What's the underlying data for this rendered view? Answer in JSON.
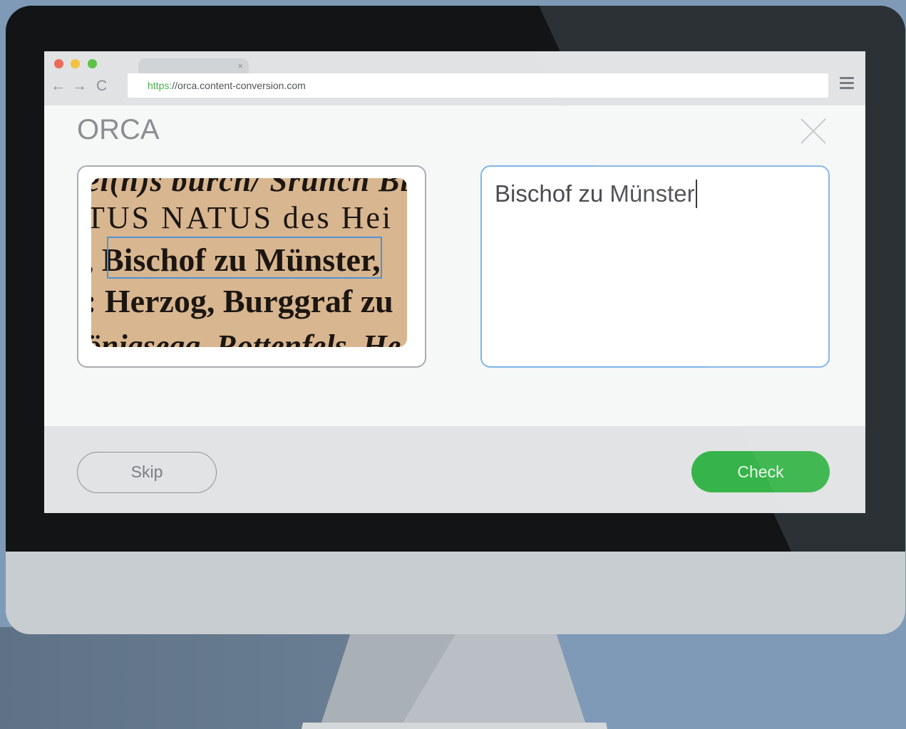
{
  "browser": {
    "tab_close": "×",
    "nav_back": "←",
    "nav_forward": "→",
    "nav_reload": "C",
    "url_scheme": "https:",
    "url_rest": "//orca.content-conversion.com"
  },
  "app": {
    "title": "ORCA"
  },
  "scan": {
    "lines": [
      "ei(h)s burch/ Sruncn Bis",
      "TUS NATUS des Hei",
      ", Bischof zu Münster,",
      ": Herzog,  Burggraf zu",
      "önigsegg, Rottenfels. He"
    ]
  },
  "transcription": {
    "value": "Bischof zu Münster"
  },
  "actions": {
    "skip_label": "Skip",
    "check_label": "Check"
  },
  "colors": {
    "accent_green": "#37b449",
    "focus_blue": "#7fb6e6",
    "highlight_blue": "#4f93d4",
    "paper": "#d8b690"
  },
  "icons": {
    "close": "close-icon",
    "menu": "hamburger-menu-icon",
    "back": "back-arrow-icon",
    "forward": "forward-arrow-icon",
    "reload": "reload-icon"
  }
}
